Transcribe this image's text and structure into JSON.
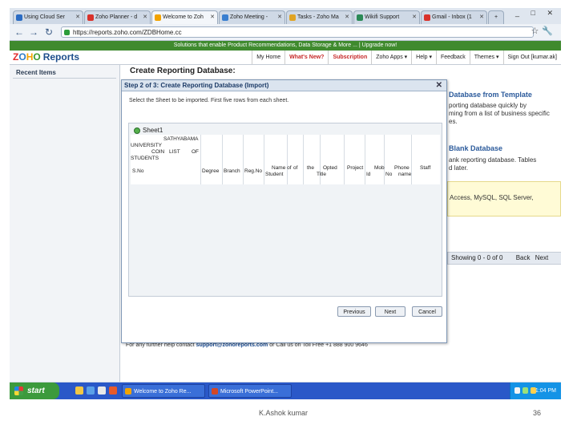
{
  "browser": {
    "tabs": [
      {
        "label": "Using Cloud Ser",
        "color": "#2b6cc4"
      },
      {
        "label": "Zoho Planner - d",
        "color": "#d9322b"
      },
      {
        "label": "Welcome to Zoh",
        "color": "#f2a300"
      },
      {
        "label": "Zoho Meeting -",
        "color": "#3a7fd0"
      },
      {
        "label": "Tasks - Zoho Ma",
        "color": "#e0a424"
      },
      {
        "label": "Wikifi Support",
        "color": "#2b8a57"
      },
      {
        "label": "Gmail - Inbox (1",
        "color": "#d9322b"
      }
    ],
    "window_controls": "_ □ ✕",
    "url": "https://reports.zoho.com/ZDBHome.cc",
    "promo": "Solutions that enable Product Recommendations, Data Storage & More ... | Upgrade now!"
  },
  "zoho": {
    "logo": {
      "z": "Z",
      "o1": "O",
      "h": "H",
      "o2": "O",
      "reports": "Reports"
    },
    "topnav": [
      {
        "label": "My Home",
        "red": false
      },
      {
        "label": "What's New?",
        "red": true
      },
      {
        "label": "Subscription",
        "red": true
      },
      {
        "label": "Zoho Apps ▾",
        "red": false
      },
      {
        "label": "Help ▾",
        "red": false
      },
      {
        "label": "Feedback",
        "red": false
      },
      {
        "label": "Themes ▾",
        "red": false
      },
      {
        "label": "Sign Out [kumar.ak]",
        "red": false
      }
    ],
    "sidebar_title": "Recent Items",
    "page_title": "Create Reporting Database:",
    "background": {
      "template_heading": "Database from Template",
      "template_line1": "porting database quickly by",
      "template_line2": "ming from a list of business specific",
      "template_line3": "es.",
      "blank_heading": "Blank Database",
      "blank_line1": "ank reporting database. Tables",
      "blank_line2": "d later.",
      "yellow_text": "Access, MySQL, SQL Server,",
      "pager_text": "Showing 0 - 0 of 0",
      "pager_back": "Back",
      "pager_next": "Next",
      "contact_prefix": "For any further help contact",
      "contact_email": "support@zohoreports.com",
      "contact_suffix": "or Call us on Toll Free +1 888 900 9646"
    },
    "dialog": {
      "title": "Step 2 of 3: Create Reporting Database (Import)",
      "close": "✕",
      "instruction": "Select the Sheet to be imported. First five rows from each sheet.",
      "sheet_name": "Sheet1",
      "cells": {
        "r1": "SATHYABAMA",
        "r2": "UNIVERSITY",
        "r3a": "COIN",
        "r3b": "LIST",
        "r3c": "OF",
        "r4": "STUDENTS",
        "h_sno": "S.No",
        "h_degree": "Degree",
        "h_branch": "Branch",
        "h_regno": "Reg.No",
        "h_name": "Name of",
        "h_name2": "Student",
        "h_of": "of",
        "h_the": "the",
        "h_the2": "Title",
        "h_opted": "Opted",
        "h_project": "Project",
        "h_id": "Id",
        "h_mob": "Mob",
        "h_no": "No",
        "h_phone": "Phone",
        "h_staff": "Staff",
        "h_staffname": "name"
      },
      "buttons": {
        "previous": "Previous",
        "next": "Next",
        "cancel": "Cancel"
      }
    }
  },
  "taskbar": {
    "start": "start",
    "items": [
      {
        "label": "Welcome to Zoho Re...",
        "color": "#f2a300"
      },
      {
        "label": "Microsoft PowerPoint...",
        "color": "#d24726"
      }
    ],
    "time": "1:04 PM"
  },
  "footer": {
    "author": "K.Ashok kumar",
    "page": "36"
  }
}
